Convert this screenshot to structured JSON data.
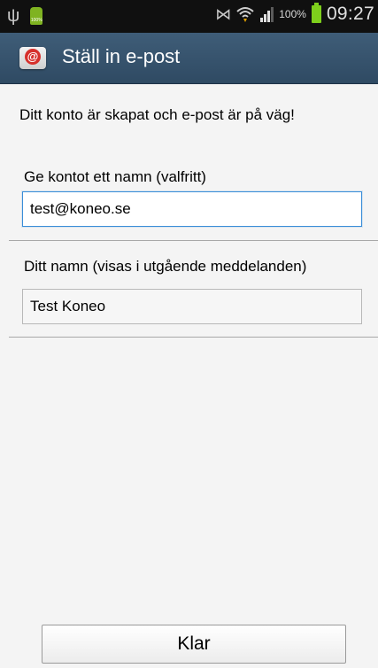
{
  "status_bar": {
    "battery_percent": "100%",
    "time": "09:27",
    "android_badge": "100%",
    "icons": [
      "usb-icon",
      "android-notification-icon",
      "mute-icon",
      "wifi-icon",
      "signal-icon",
      "battery-icon"
    ]
  },
  "action_bar": {
    "title": "Ställ in e-post",
    "icon": "email-app-icon",
    "icon_glyph": "@"
  },
  "content": {
    "intro": "Ditt konto är skapat och e-post är på väg!",
    "account_name_label": "Ge kontot ett namn (valfritt)",
    "account_name_value": "test@koneo.se",
    "your_name_label": "Ditt namn (visas i utgående meddelanden)",
    "your_name_value": "Test Koneo"
  },
  "buttons": {
    "done_label": "Klar"
  },
  "colors": {
    "action_bar": "#35526c",
    "status_bar": "#101010",
    "focus_border": "#3a8ed8",
    "battery": "#7ecf1c"
  }
}
